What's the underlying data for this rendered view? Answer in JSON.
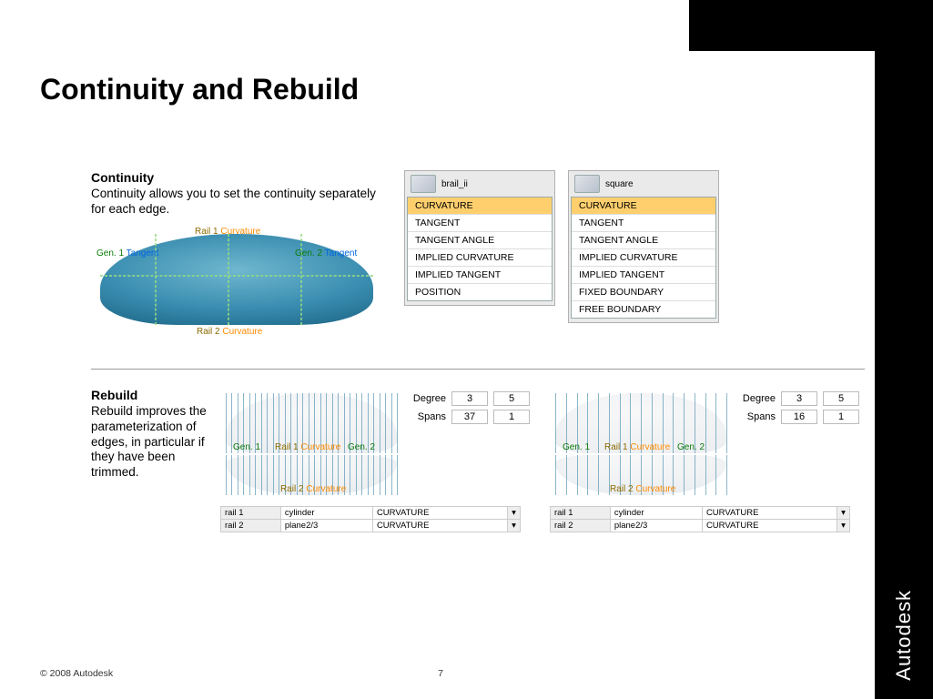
{
  "title": "Continuity and Rebuild",
  "sections": {
    "continuity": {
      "heading": "Continuity",
      "body": "Continuity allows you to set the continuity separately for each edge.",
      "labels": {
        "gen1": "Gen. 1",
        "gen1_tan": "Tangent",
        "rail1": "Rail 1",
        "rail1_curv": "Curvature",
        "gen2": "Gen. 2",
        "gen2_tan": "Tangent",
        "rail2": "Rail 2",
        "rail2_curv": "Curvature"
      },
      "menu1": {
        "thumb_label": "brail_ii",
        "items": [
          "CURVATURE",
          "TANGENT",
          "TANGENT ANGLE",
          "IMPLIED CURVATURE",
          "IMPLIED TANGENT",
          "POSITION"
        ],
        "selected": 0
      },
      "menu2": {
        "thumb_label": "square",
        "items": [
          "CURVATURE",
          "TANGENT",
          "TANGENT ANGLE",
          "IMPLIED CURVATURE",
          "IMPLIED TANGENT",
          "FIXED BOUNDARY",
          "FREE BOUNDARY"
        ],
        "selected": 0
      }
    },
    "rebuild": {
      "heading": "Rebuild",
      "body": "Rebuild improves the parameterization of edges, in particular if they have been trimmed.",
      "left": {
        "degree": "3",
        "degree2": "5",
        "spans": "37",
        "spans2": "1",
        "label_degree": "Degree",
        "label_spans": "Spans",
        "rows": [
          {
            "name": "rail 1",
            "surf": "cylinder",
            "mode": "CURVATURE"
          },
          {
            "name": "rail 2",
            "surf": "plane2/3",
            "mode": "CURVATURE"
          }
        ]
      },
      "right": {
        "degree": "3",
        "degree2": "5",
        "spans": "16",
        "spans2": "1",
        "label_degree": "Degree",
        "label_spans": "Spans",
        "rows": [
          {
            "name": "rail 1",
            "surf": "cylinder",
            "mode": "CURVATURE"
          },
          {
            "name": "rail 2",
            "surf": "plane2/3",
            "mode": "CURVATURE"
          }
        ]
      },
      "img_labels": {
        "gen1": "Gen. 1",
        "rail1": "Rail 1",
        "curv": "Curvature",
        "gen2": "Gen. 2",
        "rail2": "Rail 2",
        "rail2_curv": "Curvature"
      }
    }
  },
  "footer": {
    "copyright": "© 2008 Autodesk",
    "page": "7"
  },
  "brand": "Autodesk"
}
